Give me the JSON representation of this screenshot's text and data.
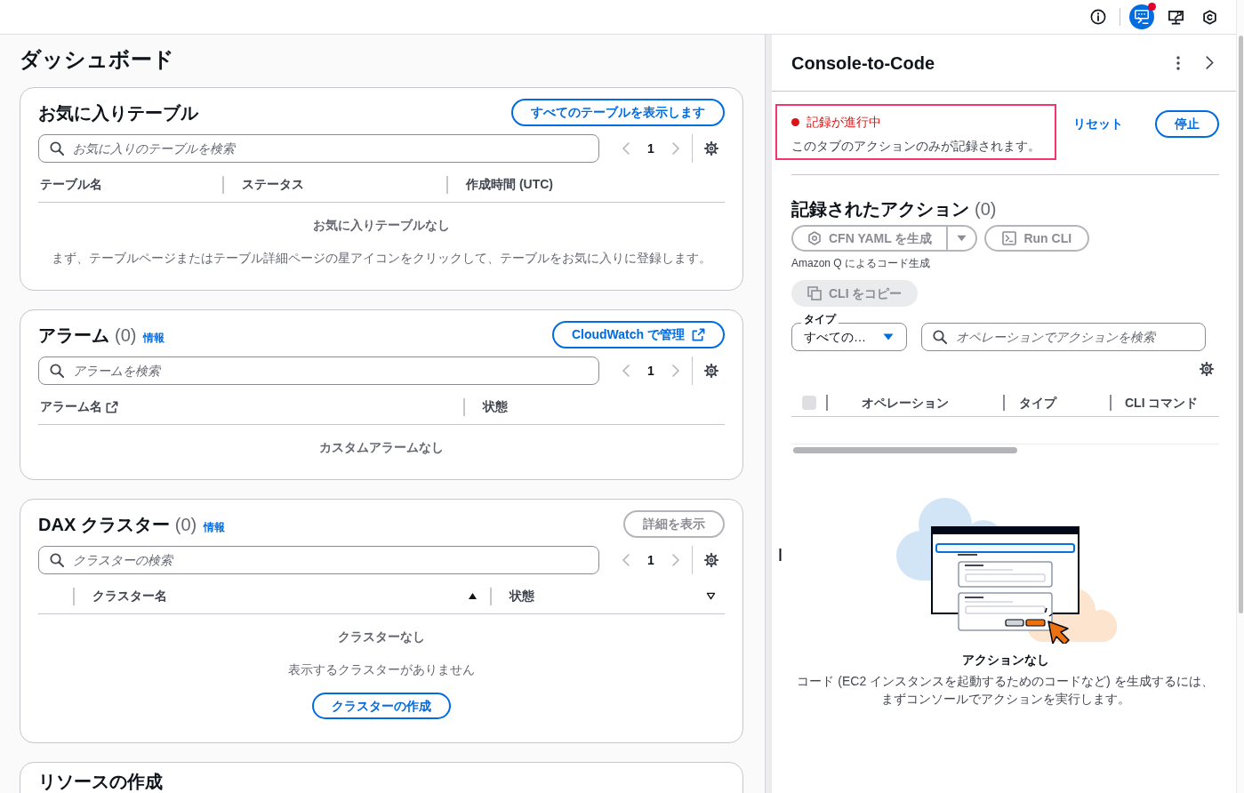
{
  "top_bar": {
    "tools": [
      {
        "kind": "info",
        "selected": false,
        "notification": false
      },
      {
        "kind": "console_to_code",
        "selected": true,
        "notification": true
      },
      {
        "kind": "monitor",
        "selected": false,
        "notification": false
      },
      {
        "kind": "hexagon",
        "selected": false,
        "notification": false
      }
    ]
  },
  "page_title": "ダッシュボード",
  "cards": [
    {
      "title": "お気に入りテーブル",
      "action": {
        "label": "すべてのテーブルを表示します",
        "disabled": false,
        "external": false
      },
      "search": {
        "placeholder": "お気に入りのテーブルを検索"
      },
      "page": "1",
      "table": {
        "columns": [
          {
            "label": "テーブル名"
          },
          {
            "label": "ステータス"
          },
          {
            "label": "作成時間 (UTC)"
          }
        ]
      },
      "empty": {
        "title": "お気に入りテーブルなし",
        "description": "まず、テーブルページまたはテーブル詳細ページの星アイコンをクリックして、テーブルをお気に入りに登録します。"
      }
    },
    {
      "title": "アラーム",
      "count": "(0)",
      "info": "情報",
      "action": {
        "label": "CloudWatch で管理",
        "disabled": false,
        "external": true
      },
      "search": {
        "placeholder": "アラームを検索"
      },
      "page": "1",
      "table": {
        "columns": [
          {
            "label": "アラーム名",
            "external": true
          },
          {
            "label": "状態",
            "external": false
          }
        ]
      },
      "empty": {
        "title": "カスタムアラームなし"
      }
    },
    {
      "title": "DAX クラスター",
      "count": "(0)",
      "info": "情報",
      "action": {
        "label": "詳細を表示",
        "disabled": true,
        "external": false
      },
      "search": {
        "placeholder": "クラスターの検索"
      },
      "page": "1",
      "table": {
        "selectable": true,
        "columns": [
          {
            "label": "クラスター名",
            "sorted": true
          },
          {
            "label": "状態",
            "sorted": false
          }
        ]
      },
      "empty": {
        "title": "クラスターなし",
        "description": "表示するクラスターがありません",
        "button": "クラスターの作成"
      }
    },
    {
      "title": "リソースの作成"
    }
  ],
  "side_panel": {
    "title": "Console-to-Code",
    "recording": {
      "active": true,
      "highlighted": true,
      "status": "記録が進行中",
      "note": "このタブのアクションのみが記録されます。"
    },
    "reset": "リセット",
    "stop": "停止",
    "recorded_actions": {
      "title": "記録されたアクション",
      "count": "(0)",
      "generate": {
        "label": "CFN YAML を生成",
        "disabled": true
      },
      "run_cli": {
        "label": "Run CLI",
        "disabled": true
      },
      "caption": "Amazon Q によるコード生成",
      "copy": {
        "label": "CLI をコピー",
        "disabled": true
      },
      "type_filter": {
        "label": "タイプ",
        "value": "すべての…"
      },
      "search": {
        "placeholder": "オペレーションでアクションを検索"
      },
      "select_all": {
        "checked": false,
        "disabled": true
      },
      "columns": [
        {
          "label": "オペレーション"
        },
        {
          "label": "タイプ"
        },
        {
          "label": "CLI コマンド"
        }
      ],
      "empty": {
        "title": "アクションなし",
        "description": "コード (EC2 インスタンスを起動するためのコードなど) を生成するには、まずコンソールでアクションを実行します。"
      }
    }
  }
}
